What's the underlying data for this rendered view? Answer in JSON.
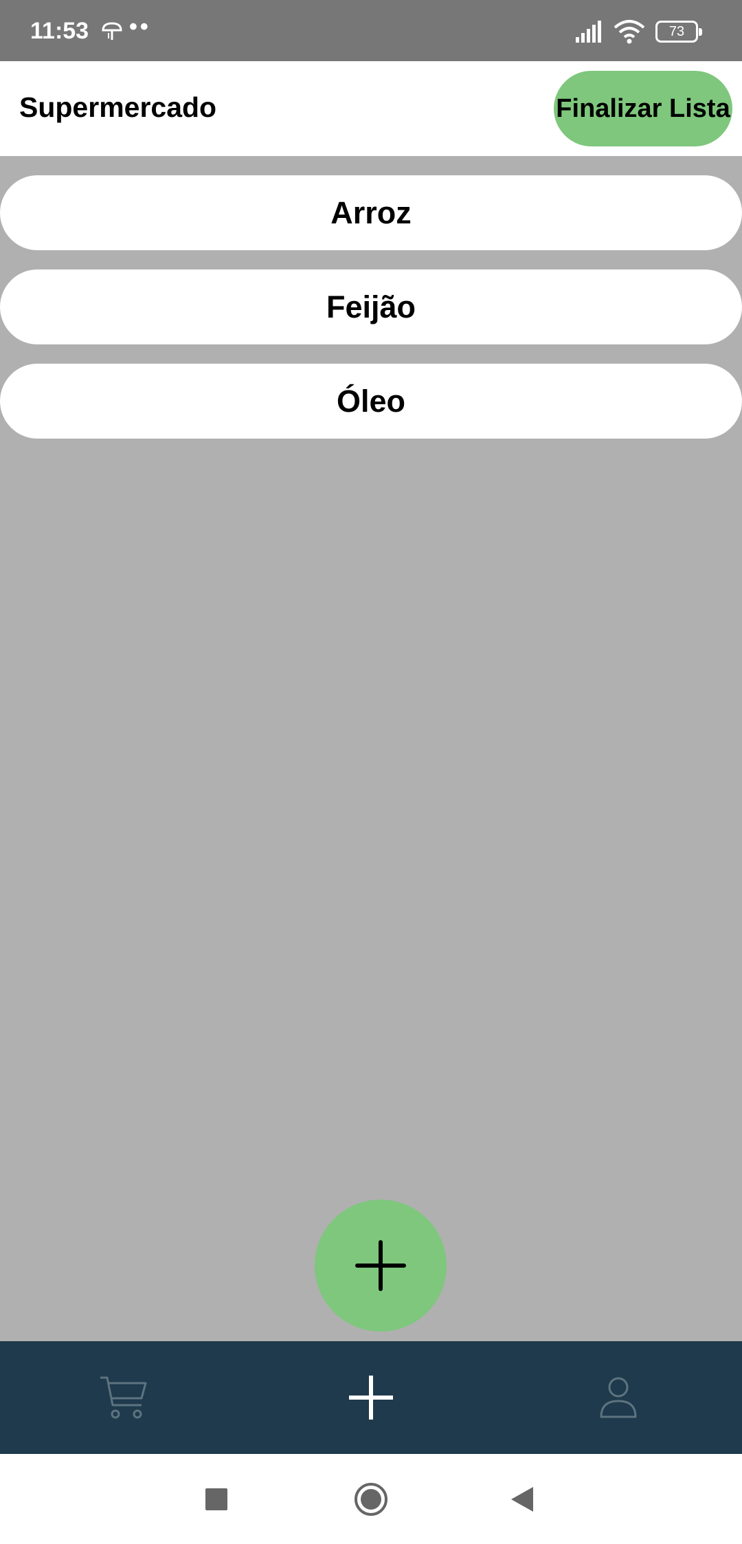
{
  "status_bar": {
    "time": "11:53",
    "dots": "••",
    "battery": "73"
  },
  "header": {
    "title": "Supermercado",
    "finish_button": "Finalizar Lista"
  },
  "items": [
    {
      "label": "Arroz"
    },
    {
      "label": "Feijão"
    },
    {
      "label": "Óleo"
    }
  ],
  "fab": {
    "icon": "plus-icon"
  },
  "bottom_nav": [
    {
      "icon": "cart-icon",
      "active": false
    },
    {
      "icon": "plus-icon",
      "active": true
    },
    {
      "icon": "user-icon",
      "active": false
    }
  ],
  "system_nav": [
    {
      "icon": "recents-square-icon"
    },
    {
      "icon": "home-circle-icon"
    },
    {
      "icon": "back-triangle-icon"
    }
  ],
  "colors": {
    "accent": "#7ec77d",
    "nav_bar": "#1e3a4c",
    "background": "#b0b0b0",
    "status_bar": "#777777",
    "inactive_icon": "#5e7380"
  }
}
